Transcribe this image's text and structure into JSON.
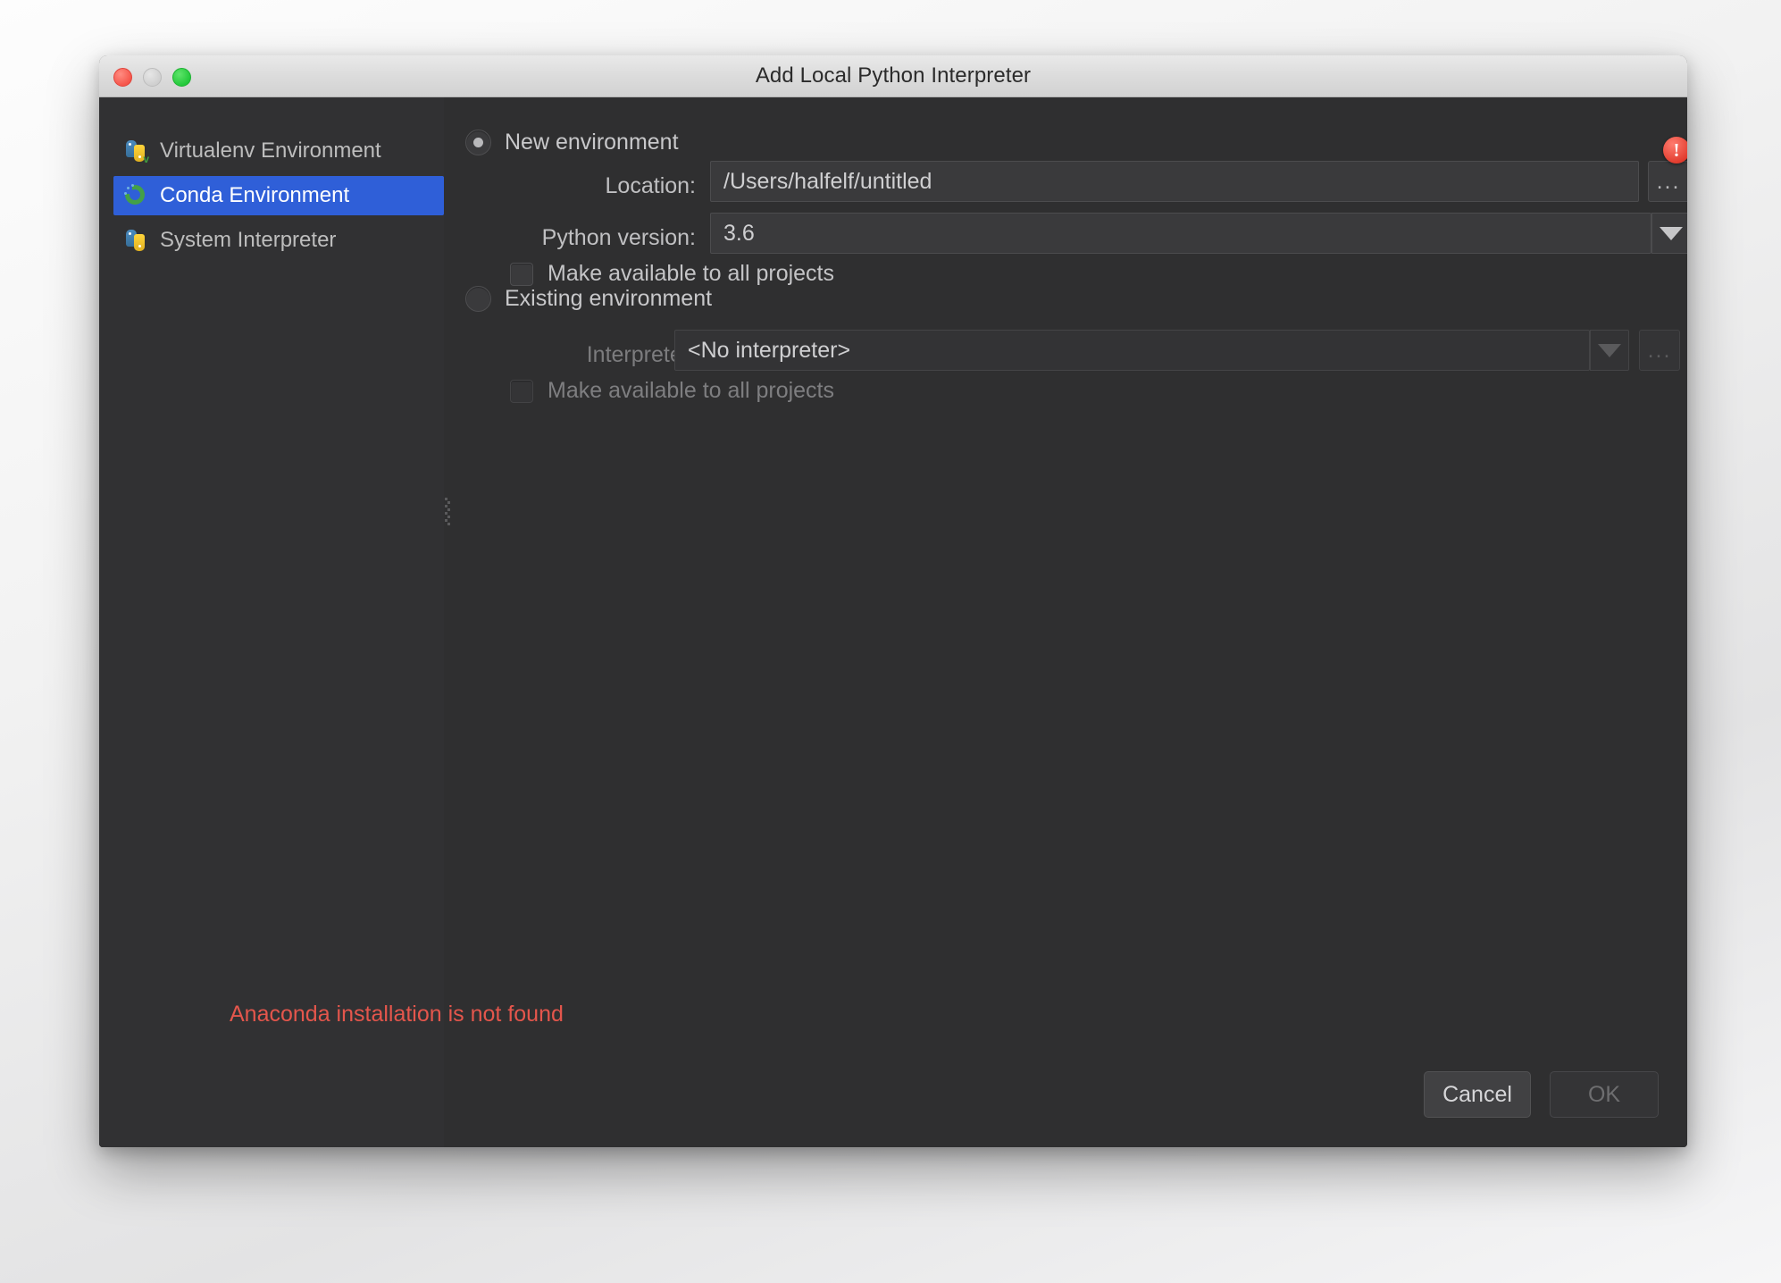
{
  "window": {
    "title": "Add Local Python Interpreter",
    "traffic_lights": [
      "close",
      "minimize",
      "zoom"
    ]
  },
  "sidebar": {
    "items": [
      {
        "label": "Virtualenv Environment",
        "icon": "python-venv-icon",
        "selected": false
      },
      {
        "label": "Conda Environment",
        "icon": "conda-icon",
        "selected": true
      },
      {
        "label": "System Interpreter",
        "icon": "python-icon",
        "selected": false
      }
    ]
  },
  "main": {
    "new_environment": {
      "radio_label": "New environment",
      "selected": true,
      "location": {
        "label": "Location:",
        "value": "/Users/halfelf/untitled",
        "browse_label": "..."
      },
      "python_version": {
        "label": "Python version:",
        "value": "3.6"
      },
      "make_available": {
        "label": "Make available to all projects",
        "checked": false
      }
    },
    "existing_environment": {
      "radio_label": "Existing environment",
      "selected": false,
      "interpreter": {
        "label": "Interpreter:",
        "value": "<No interpreter>",
        "browse_label": "..."
      },
      "make_available": {
        "label": "Make available to all projects",
        "checked": false
      }
    },
    "error_badge": "!",
    "error_message": "Anaconda installation is not found"
  },
  "footer": {
    "cancel_label": "Cancel",
    "ok_label": "OK"
  },
  "colors": {
    "accent_selected": "#2f5fd8",
    "error_red": "#e4564c",
    "dialog_bg": "#2f2f30",
    "sidebar_bg": "#313133"
  }
}
